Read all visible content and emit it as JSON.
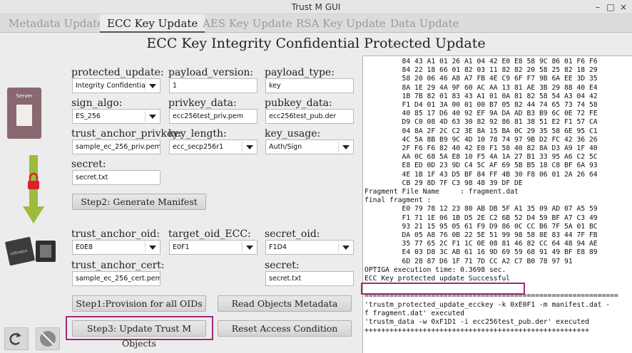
{
  "window": {
    "title": "Trust M GUI",
    "minimize": "–",
    "maximize": "□",
    "close": "×"
  },
  "tabs": [
    "Metadata Update",
    "ECC Key Update",
    "AES Key Update",
    "RSA Key Update",
    "Data Update"
  ],
  "active_tab": "ECC Key Update",
  "heading": "ECC Key Integrity Confidential Protected Update",
  "left_panel": {
    "server_label": "Server",
    "chip_brand": "infineon"
  },
  "fields": {
    "protected_update": {
      "label": "protected_update:",
      "value": "Integrity Confidentia"
    },
    "payload_version": {
      "label": "payload_version:",
      "value": "1"
    },
    "payload_type": {
      "label": "payload_type:",
      "value": "key"
    },
    "sign_algo": {
      "label": "sign_algo:",
      "value": "ES_256"
    },
    "privkey_data": {
      "label": "privkey_data:",
      "value": "ecc256test_priv.pem"
    },
    "pubkey_data": {
      "label": "pubkey_data:",
      "value": "ecc256test_pub.der"
    },
    "trust_anchor_privkey": {
      "label": "trust_anchor_privkey:",
      "value": "sample_ec_256_priv.pem"
    },
    "key_length": {
      "label": "key_length:",
      "value": "ecc_secp256r1"
    },
    "key_usage": {
      "label": "key_usage:",
      "value": "Auth/Sign"
    },
    "secret_top": {
      "label": "secret:",
      "value": "secret.txt"
    },
    "trust_anchor_oid": {
      "label": "trust_anchor_oid:",
      "value": "E0E8"
    },
    "target_oid_ecc": {
      "label": "target_oid_ECC:",
      "value": "E0F1"
    },
    "secret_oid": {
      "label": "secret_oid:",
      "value": "F1D4"
    },
    "trust_anchor_cert": {
      "label": "trust_anchor_cert:",
      "value": "sample_ec_256_cert.pem"
    },
    "secret_bottom": {
      "label": "secret:",
      "value": "secret.txt"
    }
  },
  "buttons": {
    "generate_manifest": "Step2: Generate Manifest",
    "provision": "Step1:Provision for all OIDs",
    "read_metadata": "Read Objects Metadata",
    "update_objects": "Step3: Update Trust M Objects",
    "reset_access": "Reset Access Condition"
  },
  "console_lines": [
    "         84 43 A1 01 26 A1 04 42 E0 E8 58 9C 86 01 F6 F6",
    "         84 22 18 66 01 82 03 11 82 82 20 58 25 82 18 29",
    "         58 20 06 46 A8 A7 FB 4E C9 6F F7 9B 6A EE 3D 35",
    "         8A 1E 29 4A 9F 60 AC AA 13 81 AE 3B 29 88 40 E4",
    "         1B 7B 82 01 83 43 A1 01 0A 81 82 58 54 A3 04 42",
    "         F1 D4 01 3A 00 01 00 B7 05 82 44 74 65 73 74 58",
    "         40 85 17 D6 40 92 EF 9A DA AD B3 B9 6C 0E 72 FE",
    "         D9 C0 08 4D 63 30 82 92 86 81 38 51 E2 F1 57 CA",
    "         04 8A 2F 2C C2 3E 8A 15 BA 0C 29 35 58 6E 95 C1",
    "         4C 5A 8B B9 9C 4D 10 78 74 97 9B D2 FC 42 36 26",
    "         2F F6 F6 82 40 42 E0 F1 58 40 82 8A D3 A9 1F 40",
    "         AA 0C 68 5A E8 10 F5 4A 1A 27 B1 33 95 A6 C2 5C",
    "         E8 ED 0D 23 9D C4 5C AF 69 5B B5 18 C8 BF 6A 93",
    "         4E 1B 1F 43 D5 BF 84 FF 4B 30 F8 06 01 2A 26 64",
    "         CB 29 8D 7F C3 98 48 39 DF DE",
    "Fragment File Name     : fragment.dat",
    "final fragment :",
    "         E0 79 78 12 23 80 AB DB 5F A1 35 09 AD 07 A5 59",
    "         F1 71 1E 06 1B D5 2E C2 6B 52 D4 59 BF A7 C3 49",
    "         93 21 15 95 05 61 F9 D9 86 0C CC B6 7F 5A 01 BC",
    "         DA 05 A8 76 0B 22 5E 51 99 98 58 8E 83 44 7F FB",
    "         35 77 65 2C F1 1C 0E 08 81 46 82 CC 64 48 94 AE",
    "         E4 03 D8 3C AB 61 16 9D 69 59 68 91 49 BF E8 89",
    "         6D 28 87 D6 1F 71 7D CC A2 C7 B0 78 97 91",
    "OPTIGA execution time: 0.3698 sec.",
    "ECC Key protected update Successful",
    "",
    "=============================================================",
    "'trustm_protected_update_ecckey -k 0xE0F1 -m manifest.dat -",
    "f fragment.dat' executed",
    "'trustm_data -w 0xF1D1 -i ecc256test_pub.der' executed",
    "++++++++++++++++++++++++++++++++++++++++++++++++++++++"
  ]
}
